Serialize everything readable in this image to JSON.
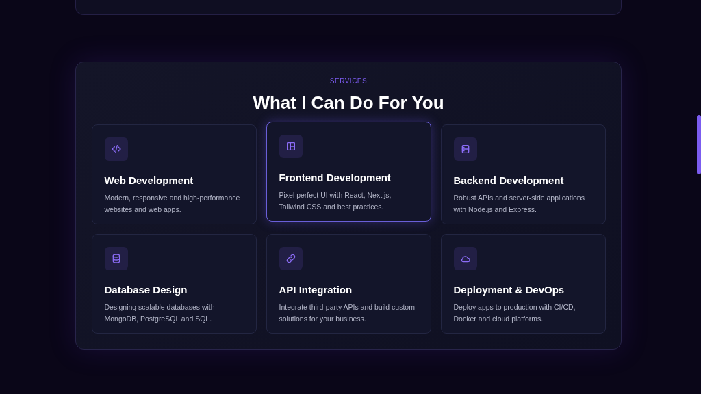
{
  "section": {
    "eyebrow": "SERVICES",
    "title": "What I Can Do For You"
  },
  "services": [
    {
      "kind": "code",
      "title": "Web Development",
      "description": "Modern, responsive and high-performance websites and web apps.",
      "selected": false
    },
    {
      "kind": "layout",
      "title": "Frontend Development",
      "description": "Pixel perfect UI with React, Next.js, Tailwind CSS and best practices.",
      "selected": true
    },
    {
      "kind": "server",
      "title": "Backend Development",
      "description": "Robust APIs and server-side applications with Node.js and Express.",
      "selected": false
    },
    {
      "kind": "database",
      "title": "Database Design",
      "description": "Designing scalable databases with MongoDB, PostgreSQL and SQL.",
      "selected": false
    },
    {
      "kind": "link",
      "title": "API Integration",
      "description": "Integrate third-party APIs and build custom solutions for your business.",
      "selected": false
    },
    {
      "kind": "cloud",
      "title": "Deployment & DevOps",
      "description": "Deploy apps to production with CI/CD, Docker and cloud platforms.",
      "selected": false
    }
  ]
}
